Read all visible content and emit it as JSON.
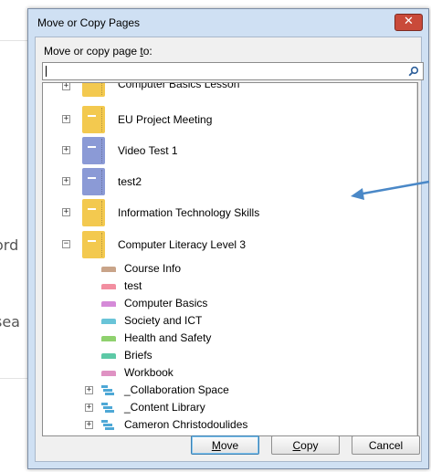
{
  "background": {
    "fragment_top": "ord",
    "fragment_bottom": "sea"
  },
  "dialog": {
    "title": "Move or Copy Pages",
    "close_glyph": "✕",
    "prompt_prefix": "Move or copy page ",
    "prompt_underlined": "t",
    "prompt_suffix": "o:",
    "search": {
      "value": "",
      "placeholder": ""
    }
  },
  "tree": {
    "notebooks": [
      {
        "label": "Computer Basics Lesson",
        "color": "#f3c94f",
        "expander": "+"
      },
      {
        "label": "EU Project Meeting",
        "color": "#f3c94f",
        "expander": "+"
      },
      {
        "label": "Video Test 1",
        "color": "#8b9ad6",
        "expander": "+"
      },
      {
        "label": "test2",
        "color": "#8b9ad6",
        "expander": "+"
      },
      {
        "label": "Information Technology Skills",
        "color": "#f3c94f",
        "expander": "+"
      },
      {
        "label": "Computer Literacy Level 3",
        "color": "#f3c94f",
        "expander": "−"
      }
    ],
    "sections": [
      {
        "label": "Course Info",
        "color": "#c9a489"
      },
      {
        "label": "test",
        "color": "#f28ea0"
      },
      {
        "label": "Computer Basics",
        "color": "#d58ad8"
      },
      {
        "label": "Society and ICT",
        "color": "#69c4d8"
      },
      {
        "label": "Health and Safety",
        "color": "#8fd16e"
      },
      {
        "label": "Briefs",
        "color": "#5dc9a6"
      },
      {
        "label": "Workbook",
        "color": "#df92c3"
      }
    ],
    "groups": [
      {
        "label": "_Collaboration Space",
        "expander": "+"
      },
      {
        "label": "_Content Library",
        "expander": "+"
      },
      {
        "label": "Cameron Christodoulides",
        "expander": "+"
      }
    ]
  },
  "buttons": {
    "move": {
      "label": "Move",
      "underline": "M"
    },
    "copy": {
      "label": "Copy",
      "underline": "C"
    },
    "cancel": {
      "label": "Cancel"
    }
  },
  "colors": {
    "annotation_arrow": "#4a88c7",
    "group_icon": "#4ea8d6"
  }
}
